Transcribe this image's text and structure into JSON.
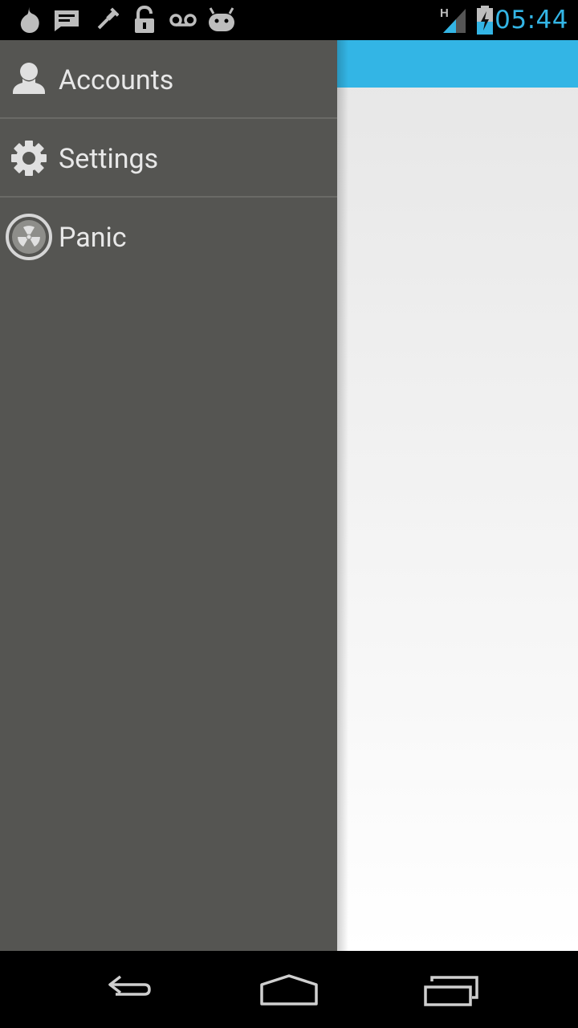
{
  "status_bar": {
    "time": "05:44",
    "time_color": "#33b5e5",
    "network_type": "H",
    "notification_icons": [
      "orbot-onion-icon",
      "message-icon",
      "tool-icon",
      "unlock-icon",
      "voicemail-icon",
      "android-icon"
    ]
  },
  "drawer": {
    "background": "#555552",
    "items": [
      {
        "label": "Accounts",
        "icon": "person-icon"
      },
      {
        "label": "Settings",
        "icon": "gear-icon"
      },
      {
        "label": "Panic",
        "icon": "radiation-icon"
      }
    ]
  },
  "content": {
    "action_bar_color": "#33b5e5"
  },
  "nav_bar": {
    "buttons": [
      "back-icon",
      "home-icon",
      "recent-apps-icon"
    ]
  }
}
